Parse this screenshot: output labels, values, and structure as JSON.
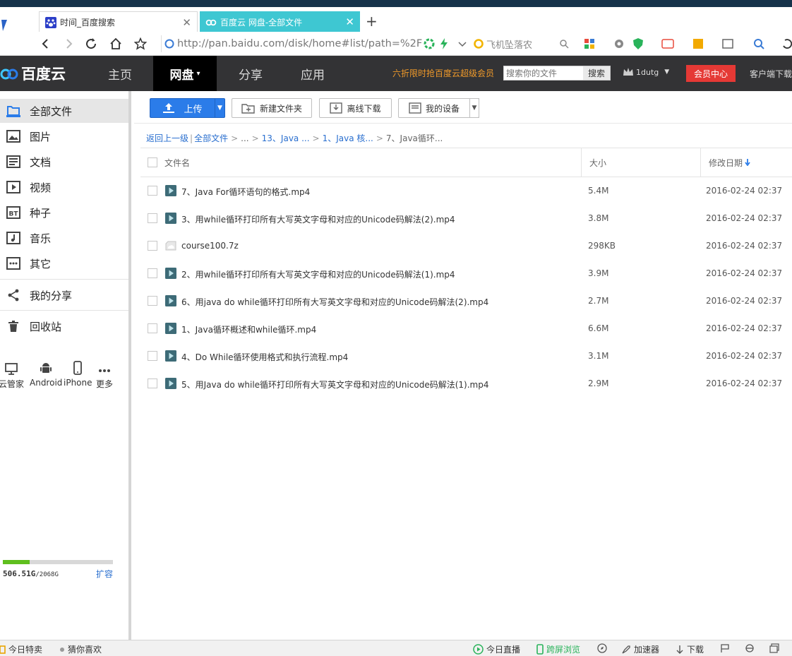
{
  "browser": {
    "tabs": [
      {
        "label": "时间_百度搜索",
        "active": false
      },
      {
        "label": "百度云 网盘-全部文件",
        "active": true
      }
    ],
    "new_tab_label": "+",
    "url": "http://pan.baidu.com/disk/home#list/path=%2F",
    "search_text": "飞机坠落农"
  },
  "header": {
    "logo": "百度云",
    "nav": [
      {
        "label": "主页",
        "active": false
      },
      {
        "label": "网盘",
        "active": true
      },
      {
        "label": "分享",
        "active": false
      },
      {
        "label": "应用",
        "active": false
      }
    ],
    "promo": "六折限时抢百度云超级会员",
    "search_placeholder": "搜索你的文件",
    "search_button": "搜索",
    "username": "1dutg",
    "vip_button": "会员中心",
    "client_download": "客户端下载"
  },
  "sidebar": {
    "categories": [
      {
        "label": "全部文件",
        "icon": "all-files-icon",
        "active": true
      },
      {
        "label": "图片",
        "icon": "image-icon",
        "active": false
      },
      {
        "label": "文档",
        "icon": "document-icon",
        "active": false
      },
      {
        "label": "视频",
        "icon": "video-icon",
        "active": false
      },
      {
        "label": "种子",
        "icon": "bt-icon",
        "active": false
      },
      {
        "label": "音乐",
        "icon": "music-icon",
        "active": false
      },
      {
        "label": "其它",
        "icon": "other-icon",
        "active": false
      }
    ],
    "my_share": "我的分享",
    "recycle": "回收站",
    "devices": [
      {
        "label": "云管家",
        "icon": "desktop-icon"
      },
      {
        "label": "Android",
        "icon": "android-icon"
      },
      {
        "label": "iPhone",
        "icon": "iphone-icon"
      },
      {
        "label": "更多",
        "icon": "more-icon"
      }
    ],
    "quota": {
      "used": "506.51G",
      "total": "/2068G",
      "used_fraction": 0.245,
      "expand": "扩容"
    }
  },
  "toolbar": {
    "upload": "上传",
    "new_folder": "新建文件夹",
    "offline_download": "离线下载",
    "my_devices": "我的设备"
  },
  "breadcrumb": {
    "back": "返回上一级",
    "items": [
      "全部文件",
      "...",
      "13、Java ...",
      "1、Java 核...",
      "7、Java循环..."
    ]
  },
  "list": {
    "columns": {
      "name": "文件名",
      "size": "大小",
      "date": "修改日期"
    },
    "files": [
      {
        "name": "7、Java For循环语句的格式.mp4",
        "type": "video",
        "size": "5.4M",
        "date": "2016-02-24 02:37"
      },
      {
        "name": "3、用while循环打印所有大写英文字母和对应的Unicode码解法(2).mp4",
        "type": "video",
        "size": "3.8M",
        "date": "2016-02-24 02:37"
      },
      {
        "name": "course100.7z",
        "type": "archive",
        "size": "298KB",
        "date": "2016-02-24 02:37"
      },
      {
        "name": "2、用while循环打印所有大写英文字母和对应的Unicode码解法(1).mp4",
        "type": "video",
        "size": "3.9M",
        "date": "2016-02-24 02:37"
      },
      {
        "name": "6、用java do while循环打印所有大写英文字母和对应的Unicode码解法(2).mp4",
        "type": "video",
        "size": "2.7M",
        "date": "2016-02-24 02:37"
      },
      {
        "name": "1、Java循环概述和while循环.mp4",
        "type": "video",
        "size": "6.6M",
        "date": "2016-02-24 02:37"
      },
      {
        "name": "4、Do While循环使用格式和执行流程.mp4",
        "type": "video",
        "size": "3.1M",
        "date": "2016-02-24 02:37"
      },
      {
        "name": "5、用Java do while循环打印所有大写英文字母和对应的Unicode码解法(1).mp4",
        "type": "video",
        "size": "2.9M",
        "date": "2016-02-24 02:37"
      }
    ]
  },
  "statusbar": {
    "items": [
      "今日特卖",
      "猜你喜欢",
      "今日直播",
      "跨屏浏览",
      "加速器",
      "下载"
    ]
  },
  "colors": {
    "header_bg": "#333335",
    "active_tab": "#3ec7d2",
    "upload_blue": "#2b7ce9",
    "vip_red": "#e53935",
    "promo_orange": "#f09a2a",
    "link_blue": "#2a6fcf",
    "quota_green": "#5fbf1e"
  }
}
